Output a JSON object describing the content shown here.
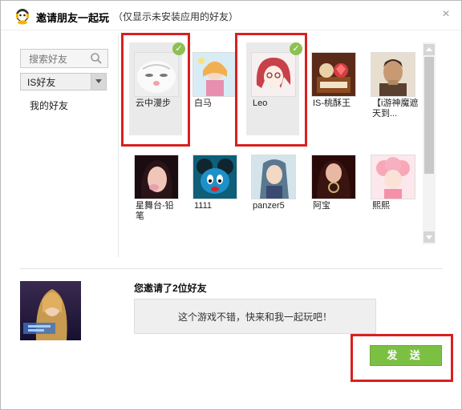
{
  "window": {
    "title": "邀请朋友一起玩",
    "subtitle": "（仅显示未安装应用的好友）",
    "close_icon": "close-icon"
  },
  "sidebar": {
    "search_placeholder": "搜索好友",
    "group_selected": "IS好友",
    "my_friends": "我的好友"
  },
  "friends": [
    {
      "name": "云中漫步",
      "selected": true,
      "avatar": "white-cat"
    },
    {
      "name": "白马",
      "selected": false,
      "avatar": "anime-girl-pink"
    },
    {
      "name": "Leo",
      "selected": true,
      "avatar": "red-hair-anime"
    },
    {
      "name": "IS-桃酥王",
      "selected": false,
      "avatar": "pastry-scene"
    },
    {
      "name": "【i游神魔遮天到...",
      "selected": false,
      "avatar": "warrior-man"
    },
    {
      "name": "星舞台-铅笔",
      "selected": false,
      "avatar": "woman-portrait"
    },
    {
      "name": "1111",
      "selected": false,
      "avatar": "blue-mouse"
    },
    {
      "name": "panzer5",
      "selected": false,
      "avatar": "anime-swordsman"
    },
    {
      "name": "阿宝",
      "selected": false,
      "avatar": "woman-necklace"
    },
    {
      "name": "熙熙",
      "selected": false,
      "avatar": "pink-hair-girl"
    }
  ],
  "invite": {
    "summary": "您邀请了2位好友",
    "message": "这个游戏不错，快来和我一起玩吧！",
    "send_label": "发 送"
  },
  "colors": {
    "accent_green": "#7bc043",
    "check_green": "#8cc152",
    "highlight_red": "#d92020"
  }
}
